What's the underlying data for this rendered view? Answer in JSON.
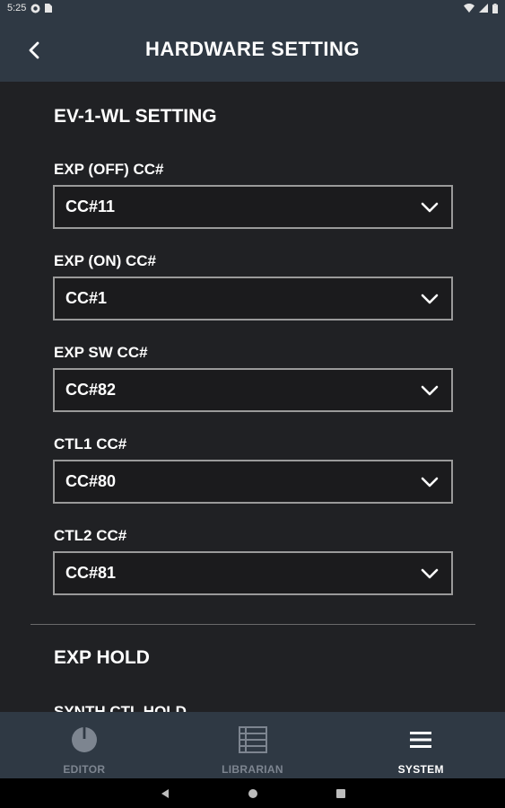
{
  "status_bar": {
    "time": "5:25"
  },
  "header": {
    "title": "HARDWARE SETTING",
    "back_icon": "chevron-left-icon"
  },
  "sections": [
    {
      "title": "EV-1-WL SETTING",
      "fields": [
        {
          "label": "EXP (OFF) CC#",
          "value": "CC#11"
        },
        {
          "label": "EXP (ON) CC#",
          "value": "CC#1"
        },
        {
          "label": "EXP SW CC#",
          "value": "CC#82"
        },
        {
          "label": "CTL1 CC#",
          "value": "CC#80"
        },
        {
          "label": "CTL2 CC#",
          "value": "CC#81"
        }
      ]
    },
    {
      "title": "EXP HOLD",
      "fields": [
        {
          "label": "SYNTH CTL HOLD"
        }
      ]
    }
  ],
  "bottom_nav": {
    "items": [
      {
        "label": "EDITOR",
        "icon": "knob-icon",
        "active": false
      },
      {
        "label": "LIBRARIAN",
        "icon": "list-icon",
        "active": false
      },
      {
        "label": "SYSTEM",
        "icon": "menu-icon",
        "active": true
      }
    ]
  },
  "colors": {
    "header_bg": "#2f3944",
    "content_bg": "#202124",
    "inactive": "#7d8590",
    "active": "#ffffff"
  }
}
